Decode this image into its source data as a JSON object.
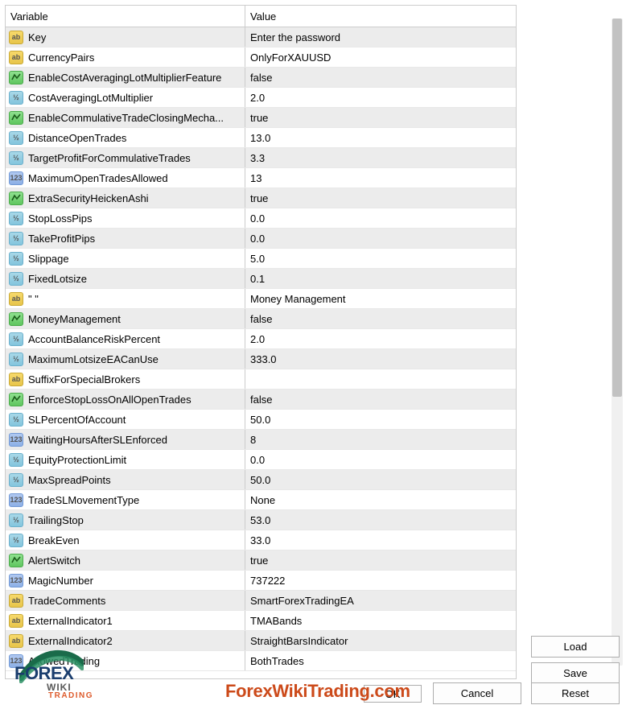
{
  "headers": {
    "variable": "Variable",
    "value": "Value"
  },
  "rows": [
    {
      "icon": "str",
      "name": "Key",
      "value": "Enter the password"
    },
    {
      "icon": "str",
      "name": "CurrencyPairs",
      "value": "OnlyForXAUUSD"
    },
    {
      "icon": "bool",
      "name": "EnableCostAveragingLotMultiplierFeature",
      "value": "false"
    },
    {
      "icon": "dbl",
      "name": "CostAveragingLotMultiplier",
      "value": "2.0"
    },
    {
      "icon": "bool",
      "name": "EnableCommulativeTradeClosingMecha...",
      "value": "true"
    },
    {
      "icon": "dbl",
      "name": "DistanceOpenTrades",
      "value": "13.0"
    },
    {
      "icon": "dbl",
      "name": "TargetProfitForCommulativeTrades",
      "value": "3.3"
    },
    {
      "icon": "int",
      "name": "MaximumOpenTradesAllowed",
      "value": "13"
    },
    {
      "icon": "bool",
      "name": "ExtraSecurityHeickenAshi",
      "value": "true"
    },
    {
      "icon": "dbl",
      "name": "StopLossPips",
      "value": "0.0"
    },
    {
      "icon": "dbl",
      "name": "TakeProfitPips",
      "value": "0.0"
    },
    {
      "icon": "dbl",
      "name": "Slippage",
      "value": "5.0"
    },
    {
      "icon": "dbl",
      "name": "FixedLotsize",
      "value": "0.1"
    },
    {
      "icon": "str",
      "name": "\" \"",
      "value": "Money Management"
    },
    {
      "icon": "bool",
      "name": "MoneyManagement",
      "value": "false"
    },
    {
      "icon": "dbl",
      "name": "AccountBalanceRiskPercent",
      "value": "2.0"
    },
    {
      "icon": "dbl",
      "name": "MaximumLotsizeEACanUse",
      "value": "333.0"
    },
    {
      "icon": "str",
      "name": "SuffixForSpecialBrokers",
      "value": ""
    },
    {
      "icon": "bool",
      "name": "EnforceStopLossOnAllOpenTrades",
      "value": "false"
    },
    {
      "icon": "dbl",
      "name": "SLPercentOfAccount",
      "value": "50.0"
    },
    {
      "icon": "int",
      "name": "WaitingHoursAfterSLEnforced",
      "value": "8"
    },
    {
      "icon": "dbl",
      "name": "EquityProtectionLimit",
      "value": "0.0"
    },
    {
      "icon": "dbl",
      "name": "MaxSpreadPoints",
      "value": "50.0"
    },
    {
      "icon": "int",
      "name": "TradeSLMovementType",
      "value": "None"
    },
    {
      "icon": "dbl",
      "name": "TrailingStop",
      "value": "53.0"
    },
    {
      "icon": "dbl",
      "name": "BreakEven",
      "value": "33.0"
    },
    {
      "icon": "bool",
      "name": "AlertSwitch",
      "value": "true"
    },
    {
      "icon": "int",
      "name": "MagicNumber",
      "value": "737222"
    },
    {
      "icon": "str",
      "name": "TradeComments",
      "value": "SmartForexTradingEA"
    },
    {
      "icon": "str",
      "name": "ExternalIndicator1",
      "value": "TMABands"
    },
    {
      "icon": "str",
      "name": "ExternalIndicator2",
      "value": "StraightBarsIndicator"
    },
    {
      "icon": "int",
      "name": "AllowedTrading",
      "value": "BothTrades"
    }
  ],
  "buttons": {
    "load": "Load",
    "save": "Save",
    "ok": "OK",
    "cancel": "Cancel",
    "reset": "Reset"
  },
  "iconLabels": {
    "str": "ab",
    "bool": "",
    "dbl": "½",
    "int": "123"
  },
  "watermark": {
    "forex": "FOREX",
    "wiki": "WIKI",
    "trading": "TRADING",
    "url": "ForexWikiTrading.com"
  }
}
